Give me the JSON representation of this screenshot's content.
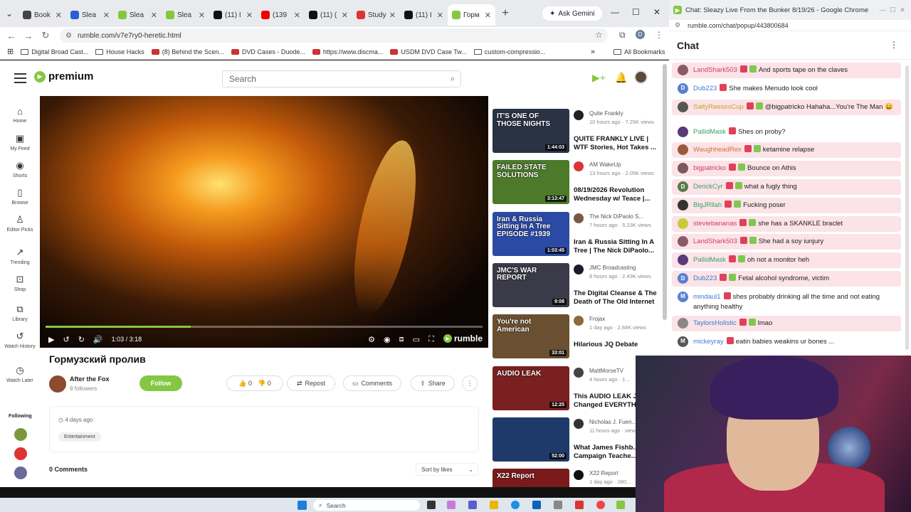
{
  "browser": {
    "tabs": [
      {
        "title": "Book",
        "icon": "star-icon",
        "color": "#444"
      },
      {
        "title": "Slea",
        "icon": "r-icon",
        "color": "#2b5fd9"
      },
      {
        "title": "Slea",
        "icon": "rumble-icon",
        "color": "#85c742"
      },
      {
        "title": "Slea",
        "icon": "rumble-icon",
        "color": "#85c742"
      },
      {
        "title": "(11) I",
        "icon": "x-icon",
        "color": "#111"
      },
      {
        "title": "(139",
        "icon": "youtube-icon",
        "color": "#e00"
      },
      {
        "title": "(11) (",
        "icon": "x-icon",
        "color": "#111"
      },
      {
        "title": "Study",
        "icon": "s-icon",
        "color": "#d33"
      },
      {
        "title": "(11) I",
        "icon": "x-icon",
        "color": "#111"
      },
      {
        "title": "Горм",
        "icon": "rumble-icon",
        "color": "#85c742",
        "active": true
      }
    ],
    "gemini_label": "Ask Gemini",
    "url": "rumble.com/v7e7ry0-heretic.html",
    "bookmarks": [
      {
        "label": "Digital Broad Cast...",
        "icon": "folder-icon"
      },
      {
        "label": "House Hacks",
        "icon": "folder-icon"
      },
      {
        "label": "(8) Behind the Scen...",
        "icon": "youtube-icon"
      },
      {
        "label": "DVD Cases - Duode...",
        "icon": "dvd-icon"
      },
      {
        "label": "https://www.discma...",
        "icon": "site-icon"
      },
      {
        "label": "USDM DVD Case Tw...",
        "icon": "site-icon"
      },
      {
        "label": "custom-compressio...",
        "icon": "folder-icon"
      }
    ],
    "bookmarks_more": "»",
    "all_bookmarks": "All Bookmarks"
  },
  "rumble": {
    "logo_text": "premium",
    "search_placeholder": "Search",
    "nav": [
      {
        "label": "Home",
        "icon": "home-icon",
        "glyph": "⌂"
      },
      {
        "label": "My Feed",
        "icon": "feed-icon",
        "glyph": "▣"
      },
      {
        "label": "Shorts",
        "icon": "shorts-icon",
        "glyph": "◉"
      },
      {
        "label": "Browse",
        "icon": "browse-icon",
        "glyph": "▯"
      },
      {
        "label": "Editor Picks",
        "icon": "editor-picks-icon",
        "glyph": "♙"
      },
      {
        "label": "Trending",
        "icon": "trending-icon",
        "glyph": "↗"
      },
      {
        "label": "Shop",
        "icon": "shop-icon",
        "glyph": "⊡"
      },
      {
        "label": "Library",
        "icon": "library-icon",
        "glyph": "⧉"
      },
      {
        "label": "Watch History",
        "icon": "history-icon",
        "glyph": "↺"
      },
      {
        "label": "Watch Later",
        "icon": "clock-icon",
        "glyph": "◷"
      }
    ],
    "following_label": "Following",
    "player": {
      "time": "1:03 / 3:18",
      "progress": 0.333,
      "brand": "rumble"
    },
    "video_title": "Гормузский пролив",
    "channel": {
      "name": "After the Fox",
      "followers": "9 followers"
    },
    "follow_label": "Follow",
    "likes": "0",
    "dislikes": "0",
    "repost_label": "Repost",
    "comments_label": "Comments",
    "share_label": "Share",
    "posted": "4 days ago",
    "category": "Entertainment",
    "comments_count": "0 Comments",
    "sort_label": "Sort by likes"
  },
  "recommendations": [
    {
      "thumb_text": "IT'S ONE OF THOSE NIGHTS",
      "duration": "1:44:03",
      "channel": "Quite Frankly",
      "meta": "10 hours ago · 7.25K views",
      "title": "QUITE FRANKLY LIVE | WTF Stories, Hot Takes ...",
      "bg": "#2a3344",
      "av": "#222"
    },
    {
      "thumb_text": "FAILED STATE SOLUTIONS",
      "duration": "3:13:47",
      "channel": "AM WakeUp",
      "meta": "13 hours ago · 2.05K views",
      "title": "08/19/2026 Revolution Wednesday w/ Teace |...",
      "bg": "#4d7a2a",
      "av": "#d33"
    },
    {
      "thumb_text": "Iran & Russia Sitting In A Tree EPISODE #1939",
      "duration": "1:03:45",
      "channel": "The Nick DiPaolo S...",
      "meta": "7 hours ago · 5.23K views",
      "title": "Iran & Russia Sitting In A Tree | The Nick DiPaolo...",
      "bg": "#2b4aa6",
      "av": "#7a5a44"
    },
    {
      "thumb_text": "JMC'S WAR REPORT",
      "duration": "9:08",
      "channel": "JMC Broadcasting",
      "meta": "8 hours ago · 2.43K views",
      "title": "The Digital Cleanse & The Death of The Old Internet",
      "bg": "#3a3a48",
      "av": "#1a1a2e"
    },
    {
      "thumb_text": "You're not American",
      "duration": "33:01",
      "channel": "Frojax",
      "meta": "1 day ago · 2.84K views",
      "title": "Hilarious JQ Debate",
      "bg": "#6a5030",
      "av": "#8a6a3a"
    },
    {
      "thumb_text": "AUDIO LEAK",
      "duration": "12:25",
      "channel": "MattMorseTV",
      "meta": "4 hours ago · 1...",
      "title": "This AUDIO LEAK J... Changed EVERYTH...",
      "bg": "#7a2020",
      "av": "#444"
    },
    {
      "thumb_text": "",
      "duration": "52:00",
      "channel": "Nicholas J. Fuen...",
      "meta": "11 hours ago · views",
      "title": "What James Fishb... Campaign Teache...",
      "bg": "#1e3a6a",
      "av": "#333"
    },
    {
      "thumb_text": "X22 Report",
      "duration": "",
      "channel": "X22 Report",
      "meta": "1 day ago · 280...",
      "title": "",
      "bg": "#7a1a1a",
      "av": "#111"
    }
  ],
  "chat": {
    "window_title": "Chat: Sleazy Live From the Bunker 8/19/26 - Google Chrome",
    "url": "rumble.com/chat/popup/443800684",
    "heading": "Chat",
    "messages": [
      {
        "user": "LandShark503",
        "text": "And sports tape on the claves",
        "ucolor": "#d1396b",
        "av": "#8a5a6a",
        "hl": true
      },
      {
        "user": "Dub223",
        "text": "She makes Menudo look cool",
        "ucolor": "#3a7bd5",
        "av": "#5b7fd1",
        "hl": false
      },
      {
        "user": "SaltyReesesCup",
        "text": "@bigpatricko Hahaha...You're The Man 😄",
        "ucolor": "#c9a227",
        "av": "#555",
        "hl": true,
        "bold_mention": true
      },
      {
        "user": "PallidMask",
        "text": "Shes on proby?",
        "ucolor": "#3aa06a",
        "av": "#5a3a7a",
        "hl": false
      },
      {
        "user": "WaughheadRex",
        "text": "ketamine relapse",
        "ucolor": "#d4703a",
        "av": "#9a5a3a",
        "hl": true
      },
      {
        "user": "bigpatricko",
        "text": "Bounce on Athis",
        "ucolor": "#d1396b",
        "av": "#7a5a5a",
        "hl": true
      },
      {
        "user": "DerickCyr",
        "text": "what a fugly thing",
        "ucolor": "#3aa06a",
        "av": "#5a7a4a",
        "hl": true
      },
      {
        "user": "BigJRllah",
        "text": "Fucking poser",
        "ucolor": "#3aa06a",
        "av": "#333",
        "hl": true
      },
      {
        "user": "steviebananas",
        "text": "she has a SKANKLE braclet",
        "ucolor": "#d1396b",
        "av": "#c9c93a",
        "hl": true
      },
      {
        "user": "LandShark503",
        "text": "She had a soy iunjury",
        "ucolor": "#d1396b",
        "av": "#8a5a6a",
        "hl": true
      },
      {
        "user": "PallidMask",
        "text": "oh not a monitor heh",
        "ucolor": "#3aa06a",
        "av": "#5a3a7a",
        "hl": true
      },
      {
        "user": "Dub223",
        "text": "Fetal alcohol syndrome, victim",
        "ucolor": "#3a7bd5",
        "av": "#5b7fd1",
        "hl": true
      },
      {
        "user": "mindaul1",
        "text": "shes probably drinking all the time and not eating anything healthy",
        "ucolor": "#3a7bd5",
        "av": "#5b7fd1",
        "hl": false
      },
      {
        "user": "TaylorsHolistic",
        "text": "lmao",
        "ucolor": "#3a7bd5",
        "av": "#888",
        "hl": true
      },
      {
        "user": "mickeyray",
        "text": "eatin babies weakins ur bones ...",
        "ucolor": "#3a7bd5",
        "av": "#555",
        "hl": false
      }
    ]
  },
  "taskbar": {
    "search_label": "Search"
  }
}
